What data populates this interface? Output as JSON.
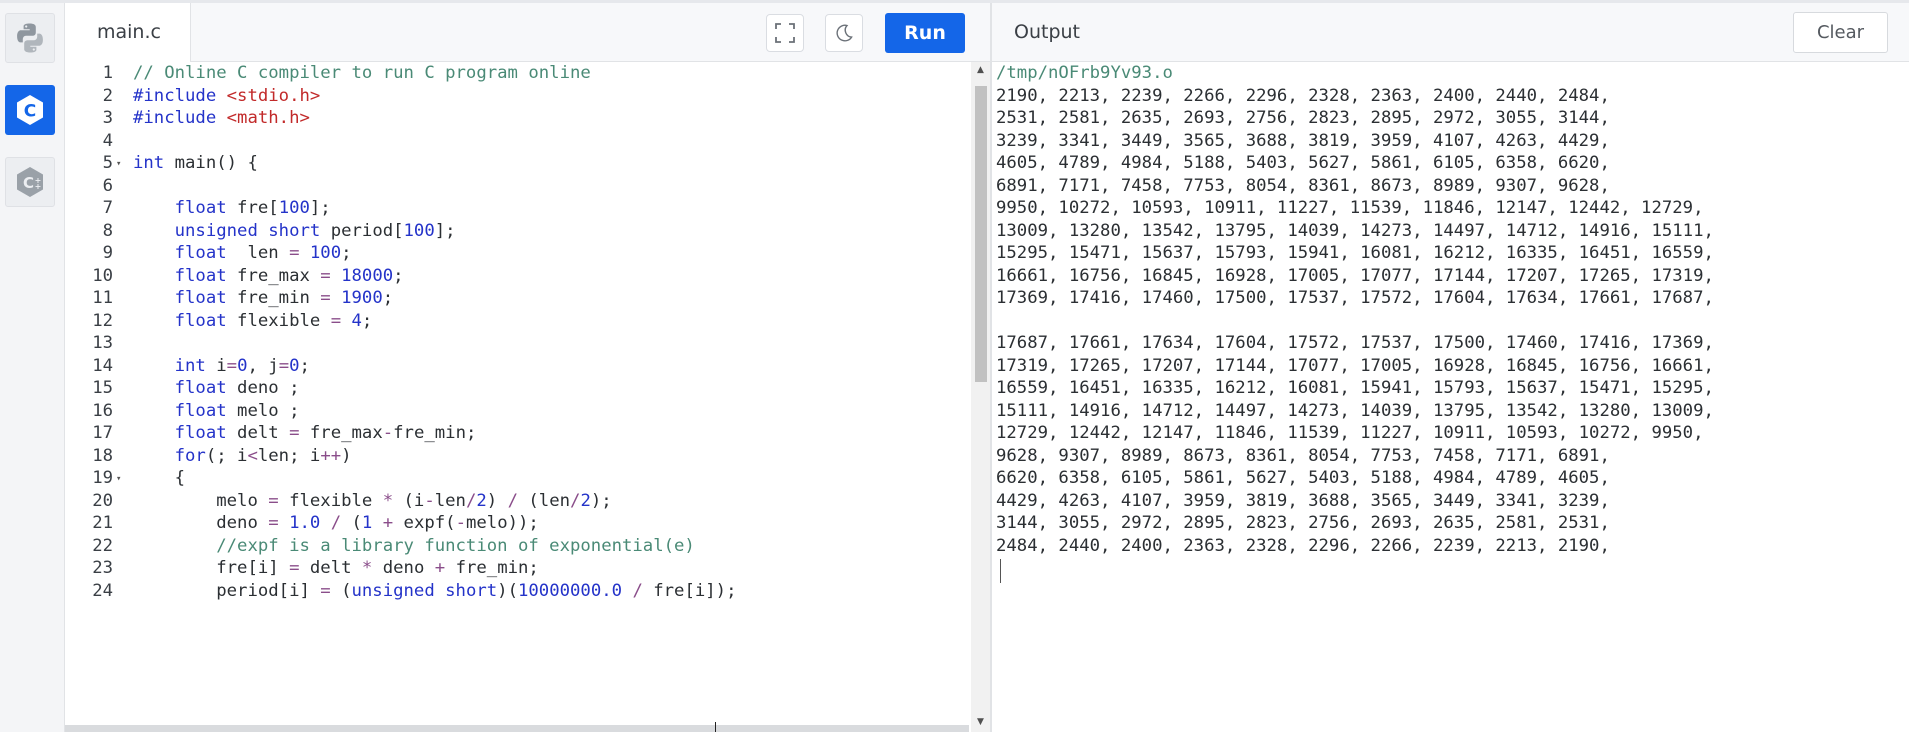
{
  "sidebar": {
    "languages": [
      {
        "name": "python",
        "icon": "python-icon",
        "active": false
      },
      {
        "name": "c",
        "icon": "c-language-icon",
        "active": true
      },
      {
        "name": "cpp",
        "icon": "cpp-language-icon",
        "active": false
      }
    ]
  },
  "editor": {
    "file_tab": "main.c",
    "run_label": "Run",
    "accent_color": "#1466e8",
    "lines": [
      {
        "n": "1",
        "tokens": [
          [
            "cm",
            "// Online C compiler to run C program online"
          ]
        ]
      },
      {
        "n": "2",
        "tokens": [
          [
            "kw",
            "#include "
          ],
          [
            "str",
            "<stdio.h>"
          ]
        ]
      },
      {
        "n": "3",
        "tokens": [
          [
            "kw",
            "#include "
          ],
          [
            "str",
            "<math.h>"
          ]
        ]
      },
      {
        "n": "4",
        "tokens": []
      },
      {
        "n": "5",
        "fold": true,
        "tokens": [
          [
            "kw",
            "int"
          ],
          [
            "",
            " main() {"
          ]
        ]
      },
      {
        "n": "6",
        "tokens": []
      },
      {
        "n": "7",
        "tokens": [
          [
            "",
            "    "
          ],
          [
            "kw",
            "float"
          ],
          [
            "",
            " fre["
          ],
          [
            "num",
            "100"
          ],
          [
            "",
            "];"
          ]
        ]
      },
      {
        "n": "8",
        "tokens": [
          [
            "",
            "    "
          ],
          [
            "kw",
            "unsigned short"
          ],
          [
            "",
            " period["
          ],
          [
            "num",
            "100"
          ],
          [
            "",
            "];"
          ]
        ]
      },
      {
        "n": "9",
        "tokens": [
          [
            "",
            "    "
          ],
          [
            "kw",
            "float"
          ],
          [
            "",
            "  len "
          ],
          [
            "op",
            "="
          ],
          [
            "",
            " "
          ],
          [
            "num",
            "100"
          ],
          [
            "",
            ";"
          ]
        ]
      },
      {
        "n": "10",
        "tokens": [
          [
            "",
            "    "
          ],
          [
            "kw",
            "float"
          ],
          [
            "",
            " fre_max "
          ],
          [
            "op",
            "="
          ],
          [
            "",
            " "
          ],
          [
            "num",
            "18000"
          ],
          [
            "",
            ";"
          ]
        ]
      },
      {
        "n": "11",
        "tokens": [
          [
            "",
            "    "
          ],
          [
            "kw",
            "float"
          ],
          [
            "",
            " fre_min "
          ],
          [
            "op",
            "="
          ],
          [
            "",
            " "
          ],
          [
            "num",
            "1900"
          ],
          [
            "",
            ";"
          ]
        ]
      },
      {
        "n": "12",
        "tokens": [
          [
            "",
            "    "
          ],
          [
            "kw",
            "float"
          ],
          [
            "",
            " flexible "
          ],
          [
            "op",
            "="
          ],
          [
            "",
            " "
          ],
          [
            "num",
            "4"
          ],
          [
            "",
            ";"
          ]
        ]
      },
      {
        "n": "13",
        "tokens": []
      },
      {
        "n": "14",
        "tokens": [
          [
            "",
            "    "
          ],
          [
            "kw",
            "int"
          ],
          [
            "",
            " i"
          ],
          [
            "op",
            "="
          ],
          [
            "num",
            "0"
          ],
          [
            "",
            ", j"
          ],
          [
            "op",
            "="
          ],
          [
            "num",
            "0"
          ],
          [
            "",
            ";"
          ]
        ]
      },
      {
        "n": "15",
        "tokens": [
          [
            "",
            "    "
          ],
          [
            "kw",
            "float"
          ],
          [
            "",
            " deno ;"
          ]
        ]
      },
      {
        "n": "16",
        "tokens": [
          [
            "",
            "    "
          ],
          [
            "kw",
            "float"
          ],
          [
            "",
            " melo ;"
          ]
        ]
      },
      {
        "n": "17",
        "tokens": [
          [
            "",
            "    "
          ],
          [
            "kw",
            "float"
          ],
          [
            "",
            " delt "
          ],
          [
            "op",
            "="
          ],
          [
            "",
            " fre_max"
          ],
          [
            "op",
            "-"
          ],
          [
            "",
            "fre_min;"
          ]
        ]
      },
      {
        "n": "18",
        "tokens": [
          [
            "",
            "    "
          ],
          [
            "kw",
            "for"
          ],
          [
            "",
            "(; i"
          ],
          [
            "op",
            "<"
          ],
          [
            "",
            "len; i"
          ],
          [
            "op",
            "++"
          ],
          [
            "",
            ")"
          ]
        ]
      },
      {
        "n": "19",
        "fold": true,
        "tokens": [
          [
            "",
            "    {"
          ]
        ]
      },
      {
        "n": "20",
        "tokens": [
          [
            "",
            "        melo "
          ],
          [
            "op",
            "="
          ],
          [
            "",
            " flexible "
          ],
          [
            "op",
            "*"
          ],
          [
            "",
            " (i"
          ],
          [
            "op",
            "-"
          ],
          [
            "",
            "len"
          ],
          [
            "op",
            "/"
          ],
          [
            "num",
            "2"
          ],
          [
            "",
            ") "
          ],
          [
            "op",
            "/"
          ],
          [
            "",
            " (len"
          ],
          [
            "op",
            "/"
          ],
          [
            "num",
            "2"
          ],
          [
            "",
            ");"
          ]
        ]
      },
      {
        "n": "21",
        "tokens": [
          [
            "",
            "        deno "
          ],
          [
            "op",
            "="
          ],
          [
            "",
            " "
          ],
          [
            "num",
            "1.0"
          ],
          [
            "",
            " "
          ],
          [
            "op",
            "/"
          ],
          [
            "",
            " ("
          ],
          [
            "num",
            "1"
          ],
          [
            "",
            " "
          ],
          [
            "op",
            "+"
          ],
          [
            "",
            " expf("
          ],
          [
            "op",
            "-"
          ],
          [
            "",
            "melo));"
          ]
        ]
      },
      {
        "n": "22",
        "tokens": [
          [
            "",
            "        "
          ],
          [
            "cm",
            "//expf is a library function of exponential(e)"
          ]
        ]
      },
      {
        "n": "23",
        "tokens": [
          [
            "",
            "        fre[i] "
          ],
          [
            "op",
            "="
          ],
          [
            "",
            " delt "
          ],
          [
            "op",
            "*"
          ],
          [
            "",
            " deno "
          ],
          [
            "op",
            "+"
          ],
          [
            "",
            " fre_min;"
          ]
        ]
      },
      {
        "n": "24",
        "tokens": [
          [
            "",
            "        period[i] "
          ],
          [
            "op",
            "="
          ],
          [
            "",
            " ("
          ],
          [
            "kw",
            "unsigned short"
          ],
          [
            "",
            ")("
          ],
          [
            "num",
            "10000000.0"
          ],
          [
            "",
            " "
          ],
          [
            "op",
            "/"
          ],
          [
            "",
            " fre[i]);"
          ]
        ]
      }
    ]
  },
  "output": {
    "title": "Output",
    "clear_label": "Clear",
    "lines": [
      {
        "kind": "path",
        "text": "/tmp/nOFrb9Yv93.o"
      },
      {
        "kind": "text",
        "text": "2190, 2213, 2239, 2266, 2296, 2328, 2363, 2400, 2440, 2484,"
      },
      {
        "kind": "text",
        "text": "2531, 2581, 2635, 2693, 2756, 2823, 2895, 2972, 3055, 3144,"
      },
      {
        "kind": "text",
        "text": "3239, 3341, 3449, 3565, 3688, 3819, 3959, 4107, 4263, 4429,"
      },
      {
        "kind": "text",
        "text": "4605, 4789, 4984, 5188, 5403, 5627, 5861, 6105, 6358, 6620,"
      },
      {
        "kind": "text",
        "text": "6891, 7171, 7458, 7753, 8054, 8361, 8673, 8989, 9307, 9628,"
      },
      {
        "kind": "text",
        "text": "9950, 10272, 10593, 10911, 11227, 11539, 11846, 12147, 12442, 12729,"
      },
      {
        "kind": "text",
        "text": "13009, 13280, 13542, 13795, 14039, 14273, 14497, 14712, 14916, 15111,"
      },
      {
        "kind": "text",
        "text": "15295, 15471, 15637, 15793, 15941, 16081, 16212, 16335, 16451, 16559,"
      },
      {
        "kind": "text",
        "text": "16661, 16756, 16845, 16928, 17005, 17077, 17144, 17207, 17265, 17319,"
      },
      {
        "kind": "text",
        "text": "17369, 17416, 17460, 17500, 17537, 17572, 17604, 17634, 17661, 17687,"
      },
      {
        "kind": "text",
        "text": ""
      },
      {
        "kind": "text",
        "text": "17687, 17661, 17634, 17604, 17572, 17537, 17500, 17460, 17416, 17369,"
      },
      {
        "kind": "text",
        "text": "17319, 17265, 17207, 17144, 17077, 17005, 16928, 16845, 16756, 16661,"
      },
      {
        "kind": "text",
        "text": "16559, 16451, 16335, 16212, 16081, 15941, 15793, 15637, 15471, 15295,"
      },
      {
        "kind": "text",
        "text": "15111, 14916, 14712, 14497, 14273, 14039, 13795, 13542, 13280, 13009,"
      },
      {
        "kind": "text",
        "text": "12729, 12442, 12147, 11846, 11539, 11227, 10911, 10593, 10272, 9950,"
      },
      {
        "kind": "text",
        "text": "9628, 9307, 8989, 8673, 8361, 8054, 7753, 7458, 7171, 6891,"
      },
      {
        "kind": "text",
        "text": "6620, 6358, 6105, 5861, 5627, 5403, 5188, 4984, 4789, 4605,"
      },
      {
        "kind": "text",
        "text": "4429, 4263, 4107, 3959, 3819, 3688, 3565, 3449, 3341, 3239,"
      },
      {
        "kind": "text",
        "text": "3144, 3055, 2972, 2895, 2823, 2756, 2693, 2635, 2581, 2531,"
      },
      {
        "kind": "text",
        "text": "2484, 2440, 2400, 2363, 2328, 2296, 2266, 2239, 2213, 2190,"
      }
    ]
  }
}
